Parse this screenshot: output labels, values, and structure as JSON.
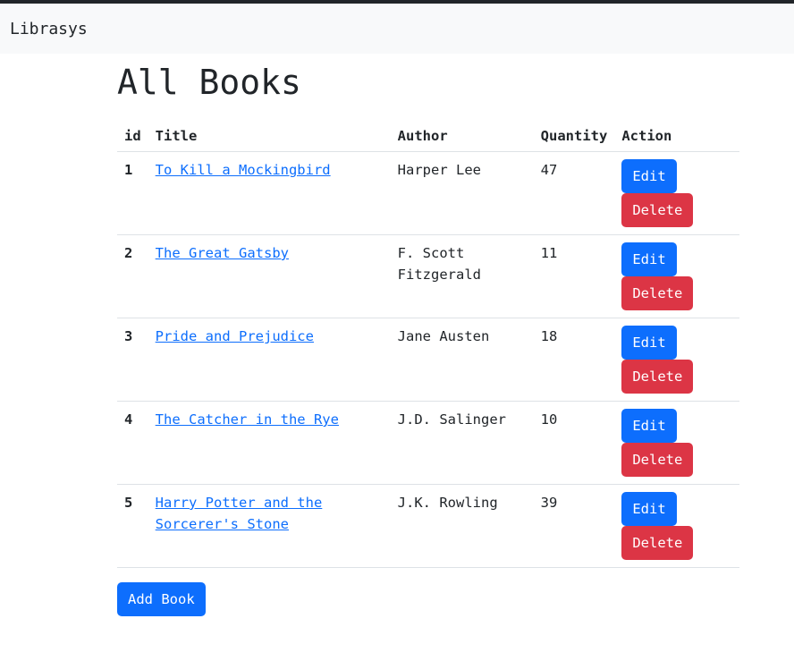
{
  "navbar": {
    "brand": "Librasys"
  },
  "main": {
    "title": "All Books",
    "table": {
      "headers": [
        "id",
        "Title",
        "Author",
        "Quantity",
        "Action"
      ],
      "rows": [
        {
          "id": "1",
          "title": "To Kill a Mockingbird",
          "author": "Harper Lee",
          "quantity": "47"
        },
        {
          "id": "2",
          "title": "The Great Gatsby",
          "author": "F. Scott Fitzgerald",
          "quantity": "11"
        },
        {
          "id": "3",
          "title": "Pride and Prejudice",
          "author": "Jane Austen",
          "quantity": "18"
        },
        {
          "id": "4",
          "title": "The Catcher in the Rye",
          "author": "J.D. Salinger",
          "quantity": "10"
        },
        {
          "id": "5",
          "title": "Harry Potter and the Sorcerer's Stone",
          "author": "J.K. Rowling",
          "quantity": "39"
        }
      ]
    },
    "edit_label": "Edit",
    "delete_label": "Delete",
    "add_label": "Add Book"
  },
  "colors": {
    "primary": "#0d6efd",
    "danger": "#dc3545",
    "navbar_bg": "#f8f9fa"
  }
}
